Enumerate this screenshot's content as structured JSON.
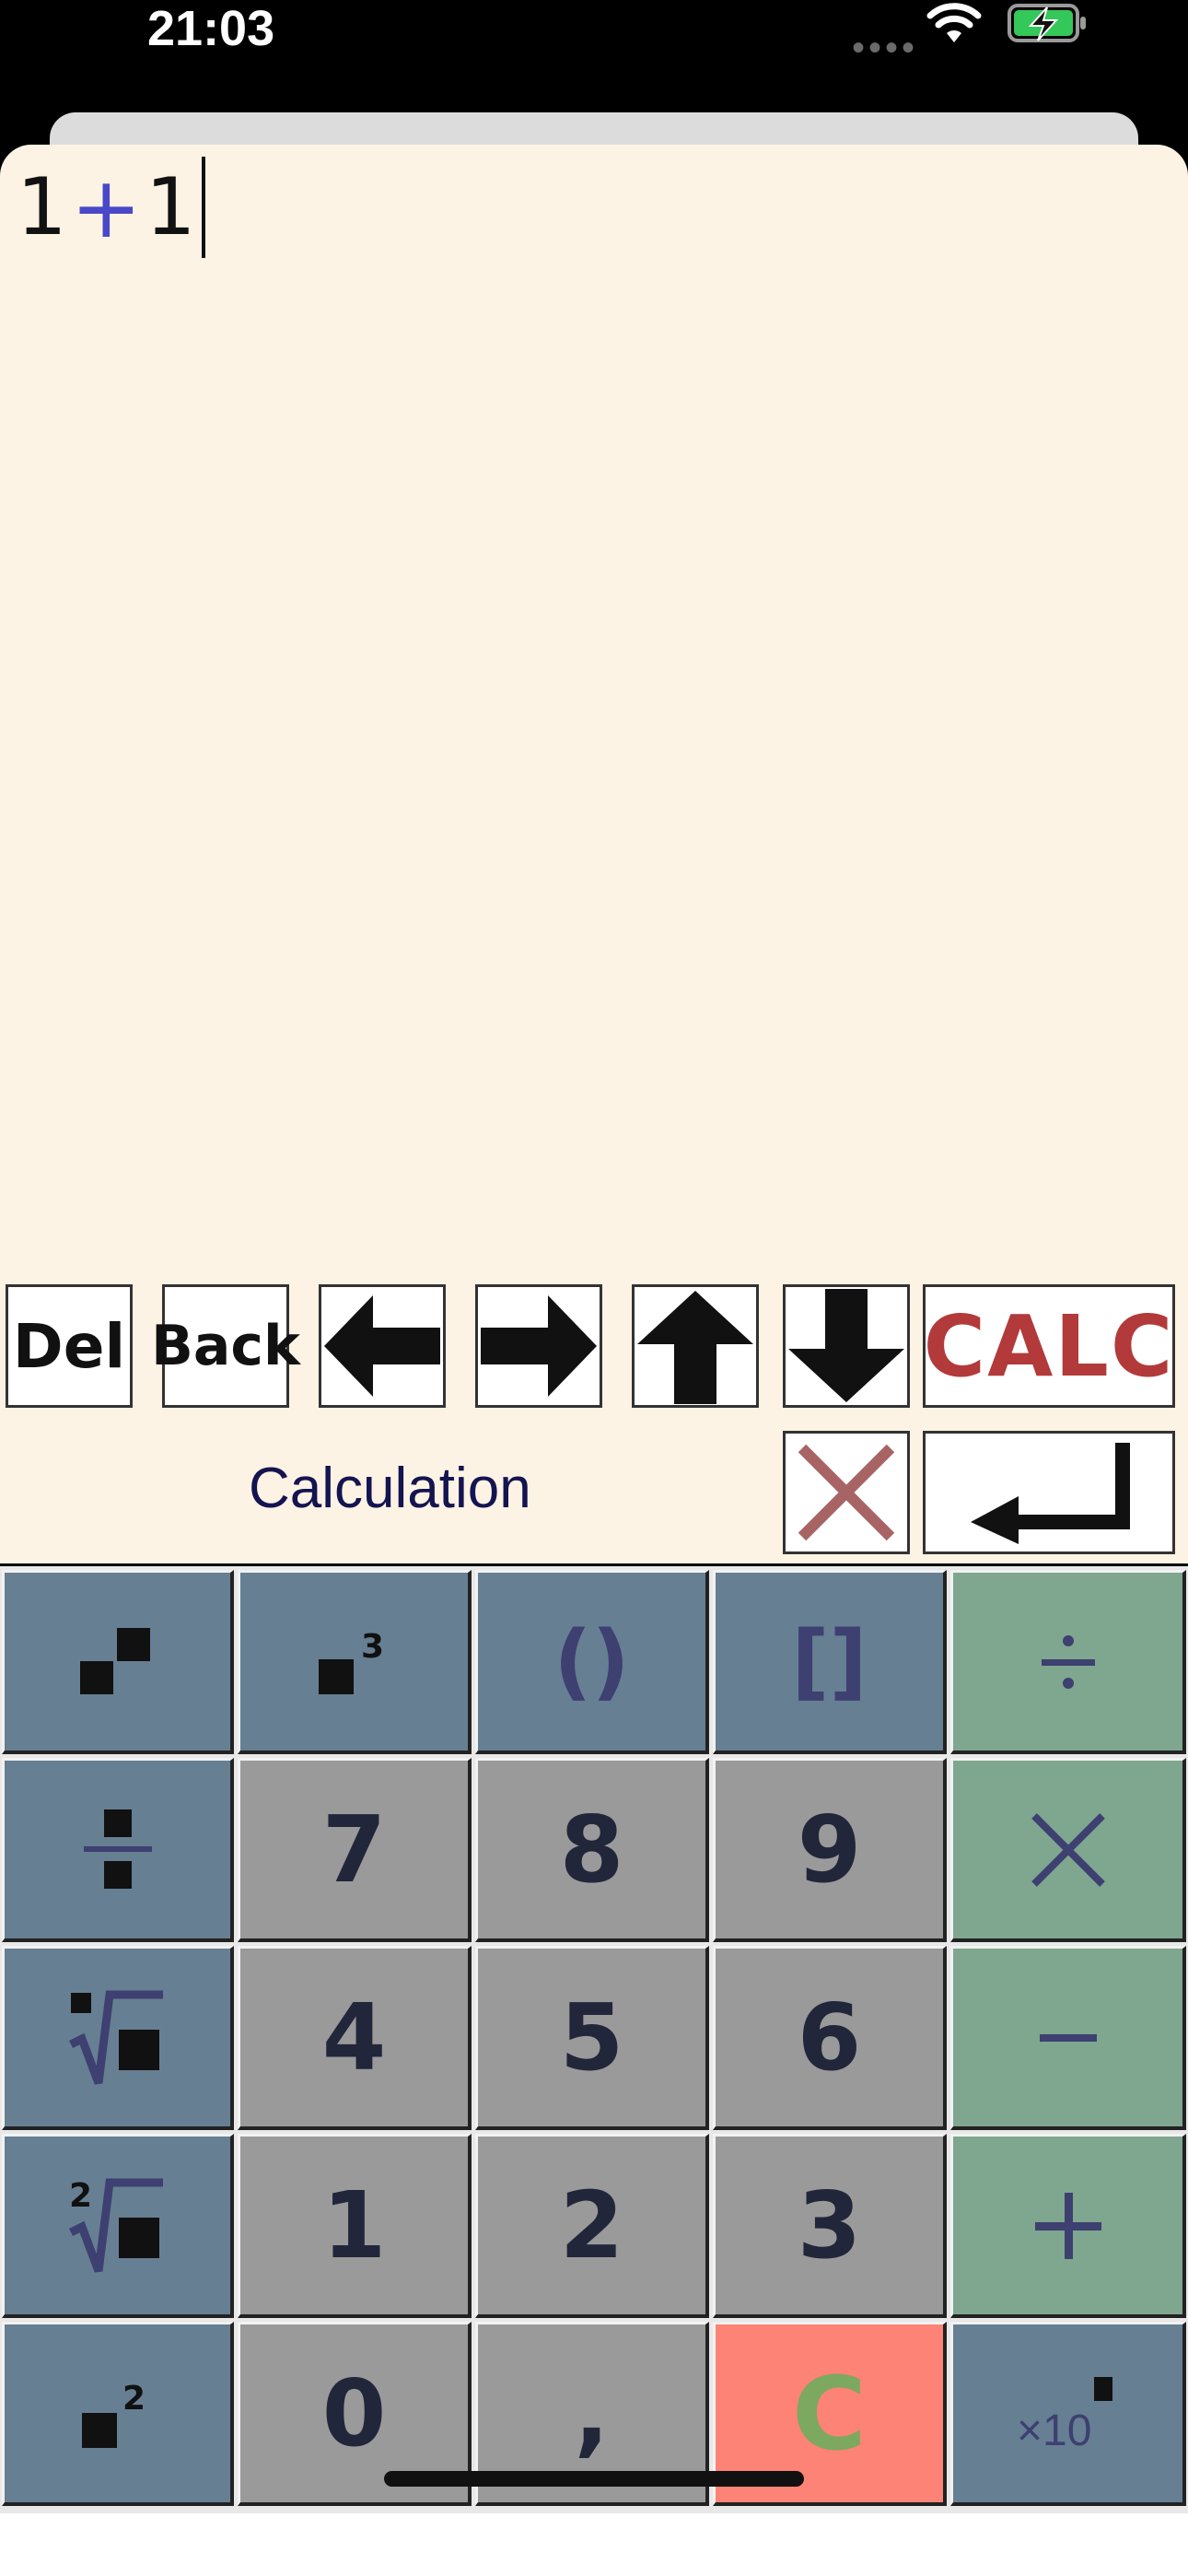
{
  "status_bar": {
    "time": "21:03",
    "signal_icon": "cellular-dots-icon",
    "wifi_icon": "wifi-icon",
    "battery_icon": "battery-charging-icon",
    "battery_color": "#34c759"
  },
  "editor": {
    "expression": {
      "left": "1",
      "operator": "+",
      "right": "1"
    },
    "operator_color": "#4848c8"
  },
  "controls": {
    "del_label": "Del",
    "back_label": "Back",
    "calc_label": "CALC",
    "left_icon": "arrow-left-icon",
    "right_icon": "arrow-right-icon",
    "up_icon": "arrow-up-icon",
    "down_icon": "arrow-down-icon",
    "close_icon": "close-x-icon",
    "enter_icon": "enter-return-icon"
  },
  "mode_label": "Calculation",
  "keypad": {
    "row1": [
      "square-icon",
      "cube-icon",
      "()",
      "[]",
      "divide-icon"
    ],
    "row2": [
      "fraction-icon",
      "7",
      "8",
      "9",
      "multiply-icon"
    ],
    "row3": [
      "nth-root-icon",
      "4",
      "5",
      "6",
      "minus-icon"
    ],
    "row4": [
      "square-root-icon",
      "1",
      "2",
      "3",
      "plus-icon"
    ],
    "row5": [
      "power-2-icon",
      "0",
      ",",
      "C",
      "times-ten-power-icon"
    ],
    "colors": {
      "function": "#667f93",
      "digit": "#9a9a9a",
      "operator": "#7fa68f",
      "clear": "#fc8375"
    },
    "cube_exponent": "3",
    "root_index": "2",
    "power_exponent": "2",
    "x10_label": "×10"
  }
}
